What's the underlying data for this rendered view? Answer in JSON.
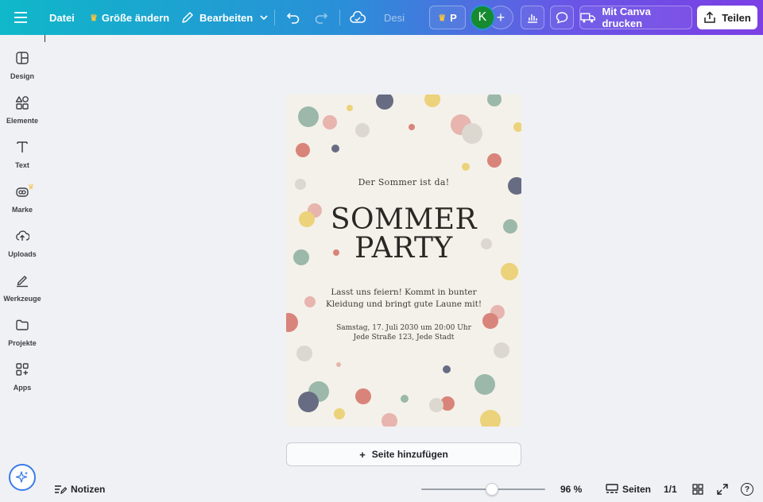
{
  "topbar": {
    "file_label": "Datei",
    "resize_label": "Größe ändern",
    "edit_label": "Bearbeiten",
    "doc_title": "Desi",
    "pro_label": "P",
    "avatar_initial": "K",
    "print_label": "Mit Canva drucken",
    "share_label": "Teilen"
  },
  "sidebar": {
    "items": [
      {
        "label": "Design"
      },
      {
        "label": "Elemente"
      },
      {
        "label": "Text"
      },
      {
        "label": "Marke"
      },
      {
        "label": "Uploads"
      },
      {
        "label": "Werkzeuge"
      },
      {
        "label": "Projekte"
      },
      {
        "label": "Apps"
      }
    ]
  },
  "design": {
    "subtitle": "Der Sommer ist da!",
    "title_line1": "SOMMER",
    "title_line2": "PARTY",
    "body_line1": "Lasst uns feiern! Kommt in bunter",
    "body_line2": "Kleidung und bringt gute Laune mit!",
    "details_line1": "Samstag, 17. Juli 2030 um 20:00 Uhr",
    "details_line2": "Jede Straße 123, Jede Stadt",
    "dot_colors": {
      "sage": "#9bb8aa",
      "rose": "#d9847a",
      "pink": "#e7b4ae",
      "navy": "#676c83",
      "yellow": "#ecd27a",
      "grey": "#dcd8d0"
    }
  },
  "canvas": {
    "add_page_label": "Seite hinzufügen"
  },
  "bottombar": {
    "notes_label": "Notizen",
    "zoom_value": "96 %",
    "zoom_fraction": 0.57,
    "pages_label": "Seiten",
    "page_count": "1/1",
    "help_label": "?"
  },
  "colors": {
    "accent": "#7b3fe4",
    "magic_ring": "#3a7bea",
    "avatar": "#168a2e"
  }
}
